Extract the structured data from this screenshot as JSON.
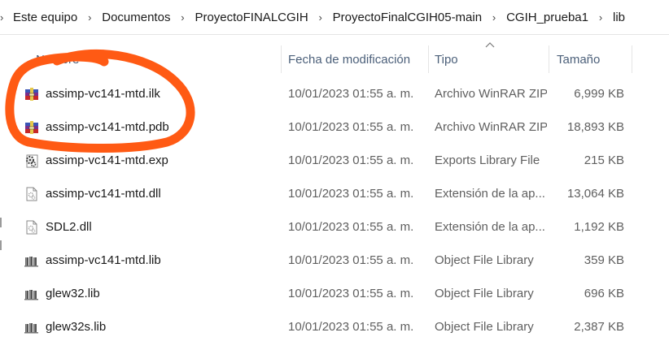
{
  "breadcrumb": {
    "items": [
      "Este equipo",
      "Documentos",
      "ProyectoFINALCGIH",
      "ProyectoFinalCGIH05-main",
      "CGIH_prueba1",
      "lib"
    ]
  },
  "columns": {
    "name": "Nombre",
    "date": "Fecha de modificación",
    "type": "Tipo",
    "size": "Tamaño"
  },
  "files": [
    {
      "name": "assimp-vc141-mtd.ilk",
      "date": "10/01/2023 01:55 a. m.",
      "type": "Archivo WinRAR ZIP",
      "size": "6,999 KB",
      "icon": "winrar-archive-icon"
    },
    {
      "name": "assimp-vc141-mtd.pdb",
      "date": "10/01/2023 01:55 a. m.",
      "type": "Archivo WinRAR ZIP",
      "size": "18,893 KB",
      "icon": "winrar-archive-icon"
    },
    {
      "name": "assimp-vc141-mtd.exp",
      "date": "10/01/2023 01:55 a. m.",
      "type": "Exports Library File",
      "size": "215 KB",
      "icon": "exports-gear-icon"
    },
    {
      "name": "assimp-vc141-mtd.dll",
      "date": "10/01/2023 01:55 a. m.",
      "type": "Extensión de la ap...",
      "size": "13,064 KB",
      "icon": "dll-file-icon"
    },
    {
      "name": "SDL2.dll",
      "date": "10/01/2023 01:55 a. m.",
      "type": "Extensión de la ap...",
      "size": "1,192 KB",
      "icon": "dll-file-icon"
    },
    {
      "name": "assimp-vc141-mtd.lib",
      "date": "10/01/2023 01:55 a. m.",
      "type": "Object File Library",
      "size": "359 KB",
      "icon": "library-books-icon"
    },
    {
      "name": "glew32.lib",
      "date": "10/01/2023 01:55 a. m.",
      "type": "Object File Library",
      "size": "696 KB",
      "icon": "library-books-icon"
    },
    {
      "name": "glew32s.lib",
      "date": "10/01/2023 01:55 a. m.",
      "type": "Object File Library",
      "size": "2,387 KB",
      "icon": "library-books-icon"
    }
  ],
  "colors": {
    "annotation_stroke": "#ff5a14",
    "header_text": "#4c607a",
    "secondary_text": "#5f5f5f"
  }
}
